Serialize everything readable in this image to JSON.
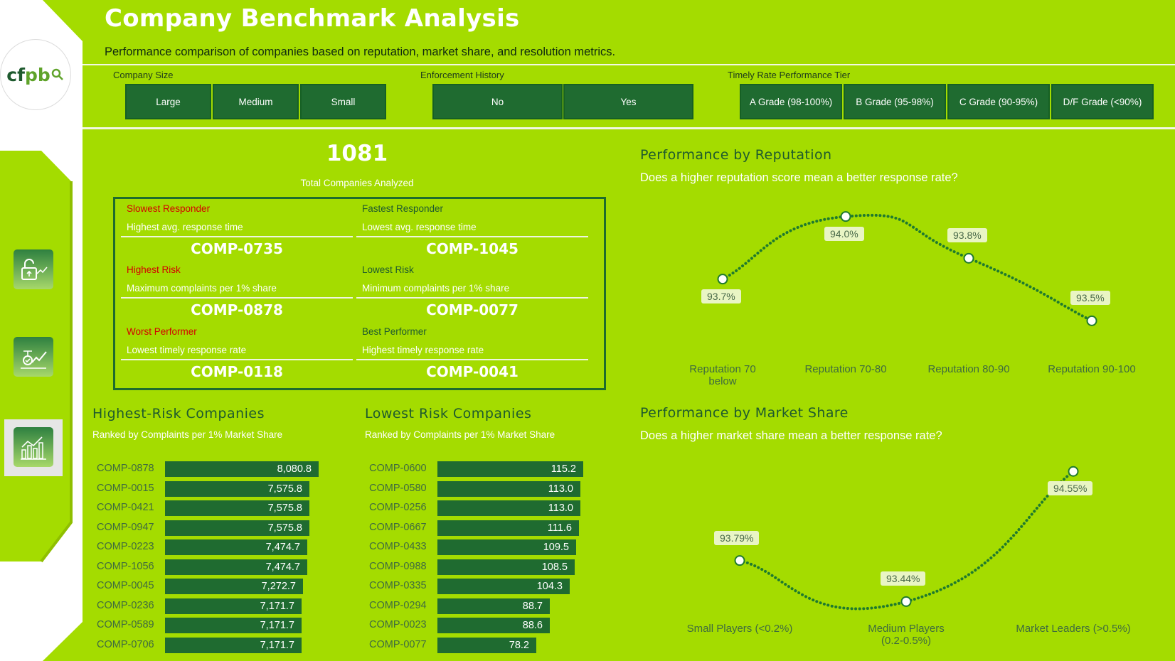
{
  "header": {
    "title": "Company Benchmark Analysis",
    "subtitle": "Performance comparison of companies based on reputation, market share, and resolution metrics."
  },
  "logo": {
    "text_cf": "cf",
    "text_pb": "pb",
    "icon": "magnifier-icon"
  },
  "colors": {
    "background": "#a4dc00",
    "accent": "#1f6b30",
    "risk": "#d40000"
  },
  "filters": {
    "company_size": {
      "label": "Company Size",
      "options": [
        "Large",
        "Medium",
        "Small"
      ]
    },
    "enforcement": {
      "label": "Enforcement History",
      "options": [
        "No",
        "Yes"
      ]
    },
    "timely_tier": {
      "label": "Timely Rate Performance Tier",
      "options": [
        "A Grade (98-100%)",
        "B Grade (95-98%)",
        "C Grade (90-95%)",
        "D/F Grade (<90%)"
      ]
    }
  },
  "nav": {
    "icons": [
      "unlock-growth-icon",
      "checkmark-trend-icon",
      "bar-chart-icon"
    ]
  },
  "kpi": {
    "value": "1081",
    "label": "Total Companies Analyzed"
  },
  "highlights": [
    {
      "title": "Slowest Responder",
      "desc": "Highest avg. response time",
      "value": "COMP-0735"
    },
    {
      "title": "Fastest Responder",
      "desc": "Lowest avg. response time",
      "value": "COMP-1045"
    },
    {
      "title": "Highest Risk",
      "desc": "Maximum complaints per 1% share",
      "value": "COMP-0878"
    },
    {
      "title": "Lowest Risk",
      "desc": "Minimum complaints per 1% share",
      "value": "COMP-0077"
    },
    {
      "title": "Worst Performer",
      "desc": "Lowest timely response rate",
      "value": "COMP-0118"
    },
    {
      "title": "Best Performer",
      "desc": "Highest timely response rate",
      "value": "COMP-0041"
    }
  ],
  "highest_risk": {
    "title": "Highest-Risk Companies",
    "subtitle": "Ranked by Complaints per 1% Market Share",
    "rows": [
      {
        "company": "COMP-0878",
        "value": 8080.8,
        "label": "8,080.8"
      },
      {
        "company": "COMP-0015",
        "value": 7575.8,
        "label": "7,575.8"
      },
      {
        "company": "COMP-0421",
        "value": 7575.8,
        "label": "7,575.8"
      },
      {
        "company": "COMP-0947",
        "value": 7575.8,
        "label": "7,575.8"
      },
      {
        "company": "COMP-0223",
        "value": 7474.7,
        "label": "7,474.7"
      },
      {
        "company": "COMP-1056",
        "value": 7474.7,
        "label": "7,474.7"
      },
      {
        "company": "COMP-0045",
        "value": 7272.7,
        "label": "7,272.7"
      },
      {
        "company": "COMP-0236",
        "value": 7171.7,
        "label": "7,171.7"
      },
      {
        "company": "COMP-0589",
        "value": 7171.7,
        "label": "7,171.7"
      },
      {
        "company": "COMP-0706",
        "value": 7171.7,
        "label": "7,171.7"
      }
    ]
  },
  "lowest_risk": {
    "title": "Lowest Risk Companies",
    "subtitle": "Ranked by Complaints per 1% Market Share",
    "rows": [
      {
        "company": "COMP-0600",
        "value": 115.2,
        "label": "115.2"
      },
      {
        "company": "COMP-0580",
        "value": 113.0,
        "label": "113.0"
      },
      {
        "company": "COMP-0256",
        "value": 113.0,
        "label": "113.0"
      },
      {
        "company": "COMP-0667",
        "value": 111.6,
        "label": "111.6"
      },
      {
        "company": "COMP-0433",
        "value": 109.5,
        "label": "109.5"
      },
      {
        "company": "COMP-0988",
        "value": 108.5,
        "label": "108.5"
      },
      {
        "company": "COMP-0335",
        "value": 104.3,
        "label": "104.3"
      },
      {
        "company": "COMP-0294",
        "value": 88.7,
        "label": "88.7"
      },
      {
        "company": "COMP-0023",
        "value": 88.6,
        "label": "88.6"
      },
      {
        "company": "COMP-0077",
        "value": 78.2,
        "label": "78.2"
      }
    ]
  },
  "chart_data": [
    {
      "type": "line",
      "title": "Performance by Reputation",
      "subtitle": "Does a higher reputation score mean a better response rate?",
      "categories": [
        "Reputation 70 below",
        "Reputation 70-80",
        "Reputation 80-90",
        "Reputation 90-100"
      ],
      "category_lines": [
        [
          "Reputation 70",
          "below"
        ],
        [
          "Reputation 70-80"
        ],
        [
          "Reputation 80-90"
        ],
        [
          "Reputation 90-100"
        ]
      ],
      "values": [
        93.7,
        94.0,
        93.8,
        93.5
      ],
      "labels": [
        "93.7%",
        "94.0%",
        "93.8%",
        "93.5%"
      ],
      "ylim": [
        93.45,
        94.05
      ]
    },
    {
      "type": "line",
      "title": "Performance by Market Share",
      "subtitle": "Does a higher market share mean a better response rate?",
      "categories": [
        "Small Players (<0.2%)",
        "Medium Players (0.2-0.5%)",
        "Market Leaders (>0.5%)"
      ],
      "category_lines": [
        [
          "Small Players (<0.2%)"
        ],
        [
          "Medium Players",
          "(0.2-0.5%)"
        ],
        [
          "Market Leaders (>0.5%)"
        ]
      ],
      "values": [
        93.79,
        93.44,
        94.55
      ],
      "labels": [
        "93.79%",
        "93.44%",
        "94.55%"
      ],
      "ylim": [
        93.4,
        94.6
      ]
    }
  ]
}
